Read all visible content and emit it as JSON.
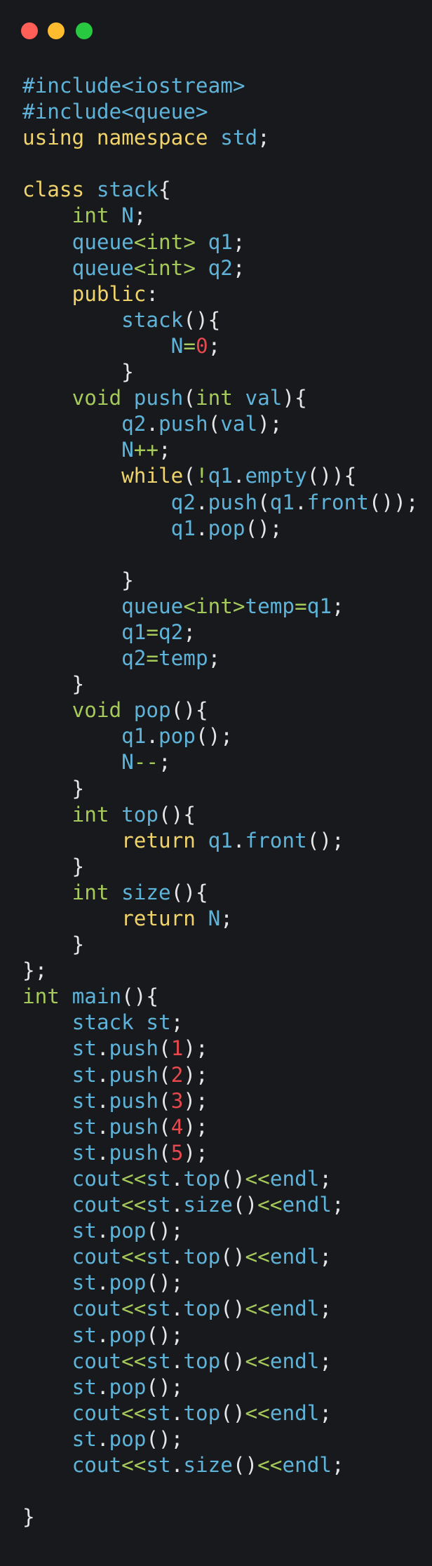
{
  "window": {
    "controls": [
      "close",
      "minimize",
      "maximize"
    ],
    "colors": {
      "close": "#ff5f57",
      "minimize": "#febc2e",
      "maximize": "#28c840",
      "background": "#17191c"
    }
  },
  "code": {
    "lines": [
      [
        [
          "id",
          "#include<iostream>"
        ]
      ],
      [
        [
          "id",
          "#include<queue>"
        ]
      ],
      [
        [
          "kw",
          "using namespace "
        ],
        [
          "id",
          "std"
        ],
        [
          "pn",
          ";"
        ]
      ],
      [],
      [
        [
          "kw",
          "class "
        ],
        [
          "id",
          "stack"
        ],
        [
          "pn",
          "{"
        ]
      ],
      [
        [
          "pn",
          "    "
        ],
        [
          "ty",
          "int "
        ],
        [
          "id",
          "N"
        ],
        [
          "pn",
          ";"
        ]
      ],
      [
        [
          "pn",
          "    "
        ],
        [
          "id",
          "queue"
        ],
        [
          "op",
          "<"
        ],
        [
          "ty",
          "int"
        ],
        [
          "op",
          "> "
        ],
        [
          "id",
          "q1"
        ],
        [
          "pn",
          ";"
        ]
      ],
      [
        [
          "pn",
          "    "
        ],
        [
          "id",
          "queue"
        ],
        [
          "op",
          "<"
        ],
        [
          "ty",
          "int"
        ],
        [
          "op",
          "> "
        ],
        [
          "id",
          "q2"
        ],
        [
          "pn",
          ";"
        ]
      ],
      [
        [
          "pn",
          "    "
        ],
        [
          "kw",
          "public"
        ],
        [
          "pn",
          ":"
        ]
      ],
      [
        [
          "pn",
          "        "
        ],
        [
          "id",
          "stack"
        ],
        [
          "pn",
          "(){"
        ]
      ],
      [
        [
          "pn",
          "            "
        ],
        [
          "id",
          "N"
        ],
        [
          "op",
          "="
        ],
        [
          "nm",
          "0"
        ],
        [
          "pn",
          ";"
        ]
      ],
      [
        [
          "pn",
          "        }"
        ]
      ],
      [
        [
          "pn",
          "    "
        ],
        [
          "ty",
          "void "
        ],
        [
          "id",
          "push"
        ],
        [
          "pn",
          "("
        ],
        [
          "ty",
          "int "
        ],
        [
          "id",
          "val"
        ],
        [
          "pn",
          "){"
        ]
      ],
      [
        [
          "pn",
          "        "
        ],
        [
          "id",
          "q2"
        ],
        [
          "pn",
          "."
        ],
        [
          "id",
          "push"
        ],
        [
          "pn",
          "("
        ],
        [
          "id",
          "val"
        ],
        [
          "pn",
          ");"
        ]
      ],
      [
        [
          "pn",
          "        "
        ],
        [
          "id",
          "N"
        ],
        [
          "op",
          "++"
        ],
        [
          "pn",
          ";"
        ]
      ],
      [
        [
          "pn",
          "        "
        ],
        [
          "kw",
          "while"
        ],
        [
          "pn",
          "("
        ],
        [
          "op",
          "!"
        ],
        [
          "id",
          "q1"
        ],
        [
          "pn",
          "."
        ],
        [
          "id",
          "empty"
        ],
        [
          "pn",
          "()){"
        ]
      ],
      [
        [
          "pn",
          "            "
        ],
        [
          "id",
          "q2"
        ],
        [
          "pn",
          "."
        ],
        [
          "id",
          "push"
        ],
        [
          "pn",
          "("
        ],
        [
          "id",
          "q1"
        ],
        [
          "pn",
          "."
        ],
        [
          "id",
          "front"
        ],
        [
          "pn",
          "());"
        ]
      ],
      [
        [
          "pn",
          "            "
        ],
        [
          "id",
          "q1"
        ],
        [
          "pn",
          "."
        ],
        [
          "id",
          "pop"
        ],
        [
          "pn",
          "();"
        ]
      ],
      [],
      [
        [
          "pn",
          "        }"
        ]
      ],
      [
        [
          "pn",
          "        "
        ],
        [
          "id",
          "queue"
        ],
        [
          "op",
          "<"
        ],
        [
          "ty",
          "int"
        ],
        [
          "op",
          ">"
        ],
        [
          "id",
          "temp"
        ],
        [
          "op",
          "="
        ],
        [
          "id",
          "q1"
        ],
        [
          "pn",
          ";"
        ]
      ],
      [
        [
          "pn",
          "        "
        ],
        [
          "id",
          "q1"
        ],
        [
          "op",
          "="
        ],
        [
          "id",
          "q2"
        ],
        [
          "pn",
          ";"
        ]
      ],
      [
        [
          "pn",
          "        "
        ],
        [
          "id",
          "q2"
        ],
        [
          "op",
          "="
        ],
        [
          "id",
          "temp"
        ],
        [
          "pn",
          ";"
        ]
      ],
      [
        [
          "pn",
          "    }"
        ]
      ],
      [
        [
          "pn",
          "    "
        ],
        [
          "ty",
          "void "
        ],
        [
          "id",
          "pop"
        ],
        [
          "pn",
          "(){"
        ]
      ],
      [
        [
          "pn",
          "        "
        ],
        [
          "id",
          "q1"
        ],
        [
          "pn",
          "."
        ],
        [
          "id",
          "pop"
        ],
        [
          "pn",
          "();"
        ]
      ],
      [
        [
          "pn",
          "        "
        ],
        [
          "id",
          "N"
        ],
        [
          "op",
          "--"
        ],
        [
          "pn",
          ";"
        ]
      ],
      [
        [
          "pn",
          "    }"
        ]
      ],
      [
        [
          "pn",
          "    "
        ],
        [
          "ty",
          "int "
        ],
        [
          "id",
          "top"
        ],
        [
          "pn",
          "(){"
        ]
      ],
      [
        [
          "pn",
          "        "
        ],
        [
          "kw",
          "return "
        ],
        [
          "id",
          "q1"
        ],
        [
          "pn",
          "."
        ],
        [
          "id",
          "front"
        ],
        [
          "pn",
          "();"
        ]
      ],
      [
        [
          "pn",
          "    }"
        ]
      ],
      [
        [
          "pn",
          "    "
        ],
        [
          "ty",
          "int "
        ],
        [
          "id",
          "size"
        ],
        [
          "pn",
          "(){"
        ]
      ],
      [
        [
          "pn",
          "        "
        ],
        [
          "kw",
          "return "
        ],
        [
          "id",
          "N"
        ],
        [
          "pn",
          ";"
        ]
      ],
      [
        [
          "pn",
          "    }"
        ]
      ],
      [
        [
          "pn",
          "};"
        ]
      ],
      [
        [
          "ty",
          "int "
        ],
        [
          "id",
          "main"
        ],
        [
          "pn",
          "(){"
        ]
      ],
      [
        [
          "pn",
          "    "
        ],
        [
          "id",
          "stack "
        ],
        [
          "id",
          "st"
        ],
        [
          "pn",
          ";"
        ]
      ],
      [
        [
          "pn",
          "    "
        ],
        [
          "id",
          "st"
        ],
        [
          "pn",
          "."
        ],
        [
          "id",
          "push"
        ],
        [
          "pn",
          "("
        ],
        [
          "nm",
          "1"
        ],
        [
          "pn",
          ");"
        ]
      ],
      [
        [
          "pn",
          "    "
        ],
        [
          "id",
          "st"
        ],
        [
          "pn",
          "."
        ],
        [
          "id",
          "push"
        ],
        [
          "pn",
          "("
        ],
        [
          "nm",
          "2"
        ],
        [
          "pn",
          ");"
        ]
      ],
      [
        [
          "pn",
          "    "
        ],
        [
          "id",
          "st"
        ],
        [
          "pn",
          "."
        ],
        [
          "id",
          "push"
        ],
        [
          "pn",
          "("
        ],
        [
          "nm",
          "3"
        ],
        [
          "pn",
          ");"
        ]
      ],
      [
        [
          "pn",
          "    "
        ],
        [
          "id",
          "st"
        ],
        [
          "pn",
          "."
        ],
        [
          "id",
          "push"
        ],
        [
          "pn",
          "("
        ],
        [
          "nm",
          "4"
        ],
        [
          "pn",
          ");"
        ]
      ],
      [
        [
          "pn",
          "    "
        ],
        [
          "id",
          "st"
        ],
        [
          "pn",
          "."
        ],
        [
          "id",
          "push"
        ],
        [
          "pn",
          "("
        ],
        [
          "nm",
          "5"
        ],
        [
          "pn",
          ");"
        ]
      ],
      [
        [
          "pn",
          "    "
        ],
        [
          "id",
          "cout"
        ],
        [
          "op",
          "<<"
        ],
        [
          "id",
          "st"
        ],
        [
          "pn",
          "."
        ],
        [
          "id",
          "top"
        ],
        [
          "pn",
          "()"
        ],
        [
          "op",
          "<<"
        ],
        [
          "id",
          "endl"
        ],
        [
          "pn",
          ";"
        ]
      ],
      [
        [
          "pn",
          "    "
        ],
        [
          "id",
          "cout"
        ],
        [
          "op",
          "<<"
        ],
        [
          "id",
          "st"
        ],
        [
          "pn",
          "."
        ],
        [
          "id",
          "size"
        ],
        [
          "pn",
          "()"
        ],
        [
          "op",
          "<<"
        ],
        [
          "id",
          "endl"
        ],
        [
          "pn",
          ";"
        ]
      ],
      [
        [
          "pn",
          "    "
        ],
        [
          "id",
          "st"
        ],
        [
          "pn",
          "."
        ],
        [
          "id",
          "pop"
        ],
        [
          "pn",
          "();"
        ]
      ],
      [
        [
          "pn",
          "    "
        ],
        [
          "id",
          "cout"
        ],
        [
          "op",
          "<<"
        ],
        [
          "id",
          "st"
        ],
        [
          "pn",
          "."
        ],
        [
          "id",
          "top"
        ],
        [
          "pn",
          "()"
        ],
        [
          "op",
          "<<"
        ],
        [
          "id",
          "endl"
        ],
        [
          "pn",
          ";"
        ]
      ],
      [
        [
          "pn",
          "    "
        ],
        [
          "id",
          "st"
        ],
        [
          "pn",
          "."
        ],
        [
          "id",
          "pop"
        ],
        [
          "pn",
          "();"
        ]
      ],
      [
        [
          "pn",
          "    "
        ],
        [
          "id",
          "cout"
        ],
        [
          "op",
          "<<"
        ],
        [
          "id",
          "st"
        ],
        [
          "pn",
          "."
        ],
        [
          "id",
          "top"
        ],
        [
          "pn",
          "()"
        ],
        [
          "op",
          "<<"
        ],
        [
          "id",
          "endl"
        ],
        [
          "pn",
          ";"
        ]
      ],
      [
        [
          "pn",
          "    "
        ],
        [
          "id",
          "st"
        ],
        [
          "pn",
          "."
        ],
        [
          "id",
          "pop"
        ],
        [
          "pn",
          "();"
        ]
      ],
      [
        [
          "pn",
          "    "
        ],
        [
          "id",
          "cout"
        ],
        [
          "op",
          "<<"
        ],
        [
          "id",
          "st"
        ],
        [
          "pn",
          "."
        ],
        [
          "id",
          "top"
        ],
        [
          "pn",
          "()"
        ],
        [
          "op",
          "<<"
        ],
        [
          "id",
          "endl"
        ],
        [
          "pn",
          ";"
        ]
      ],
      [
        [
          "pn",
          "    "
        ],
        [
          "id",
          "st"
        ],
        [
          "pn",
          "."
        ],
        [
          "id",
          "pop"
        ],
        [
          "pn",
          "();"
        ]
      ],
      [
        [
          "pn",
          "    "
        ],
        [
          "id",
          "cout"
        ],
        [
          "op",
          "<<"
        ],
        [
          "id",
          "st"
        ],
        [
          "pn",
          "."
        ],
        [
          "id",
          "top"
        ],
        [
          "pn",
          "()"
        ],
        [
          "op",
          "<<"
        ],
        [
          "id",
          "endl"
        ],
        [
          "pn",
          ";"
        ]
      ],
      [
        [
          "pn",
          "    "
        ],
        [
          "id",
          "st"
        ],
        [
          "pn",
          "."
        ],
        [
          "id",
          "pop"
        ],
        [
          "pn",
          "();"
        ]
      ],
      [
        [
          "pn",
          "    "
        ],
        [
          "id",
          "cout"
        ],
        [
          "op",
          "<<"
        ],
        [
          "id",
          "st"
        ],
        [
          "pn",
          "."
        ],
        [
          "id",
          "size"
        ],
        [
          "pn",
          "()"
        ],
        [
          "op",
          "<<"
        ],
        [
          "id",
          "endl"
        ],
        [
          "pn",
          ";"
        ]
      ],
      [],
      [
        [
          "pn",
          "}"
        ]
      ]
    ]
  }
}
